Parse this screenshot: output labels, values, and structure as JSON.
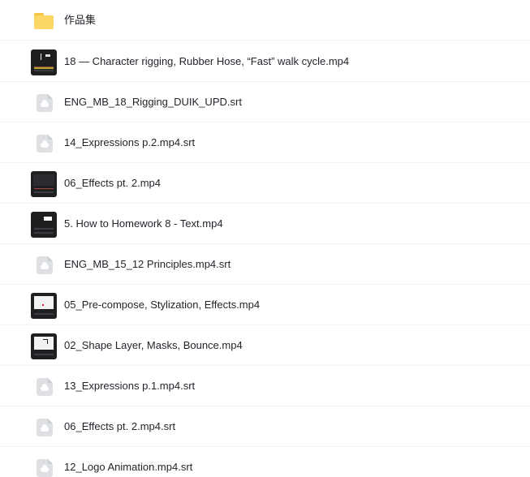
{
  "files": [
    {
      "name": "作品集",
      "icon": "folder-icon"
    },
    {
      "name": "18 — Character rigging, Rubber Hose, “Fast” walk cycle.mp4",
      "icon": "video-thumbnail-icon"
    },
    {
      "name": "ENG_MB_18_Rigging_DUIK_UPD.srt",
      "icon": "file-icon"
    },
    {
      "name": "14_Expressions p.2.mp4.srt",
      "icon": "file-icon"
    },
    {
      "name": "06_Effects pt. 2.mp4",
      "icon": "video-thumbnail-icon"
    },
    {
      "name": "5. How to Homework 8 - Text.mp4",
      "icon": "video-thumbnail-icon"
    },
    {
      "name": "ENG_MB_15_12 Principles.mp4.srt",
      "icon": "file-icon"
    },
    {
      "name": "05_Pre-compose, Stylization, Effects.mp4",
      "icon": "video-thumbnail-icon"
    },
    {
      "name": "02_Shape Layer, Masks, Bounce.mp4",
      "icon": "video-thumbnail-icon"
    },
    {
      "name": "13_Expressions p.1.mp4.srt",
      "icon": "file-icon"
    },
    {
      "name": "06_Effects pt. 2.mp4.srt",
      "icon": "file-icon"
    },
    {
      "name": "12_Logo Animation.mp4.srt",
      "icon": "file-icon"
    }
  ],
  "colors": {
    "folder": "#fdd766",
    "file_icon": "#dee0e3",
    "text": "#1f2329",
    "divider": "#f2f3f5"
  }
}
